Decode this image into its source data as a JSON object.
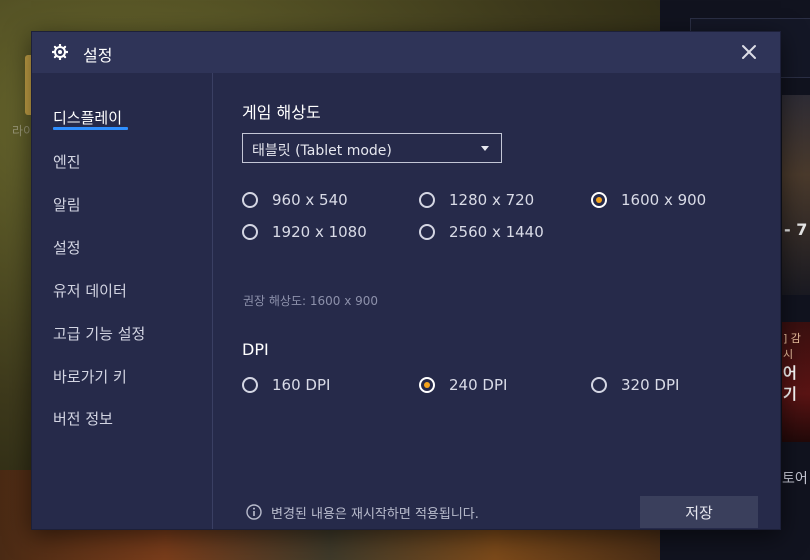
{
  "background": {
    "left_label": "라이",
    "right_card_text": "- 7",
    "right_card2_top": "] 감시",
    "right_card2_text": "어 기",
    "right_side_label": "토어"
  },
  "dialog": {
    "title": "설정",
    "icons": {
      "title": "gear-icon",
      "close": "close-icon",
      "info": "info-icon"
    },
    "colors": {
      "accent_underline": "#2f8fff",
      "radio_selected": "#f5a31b",
      "dialog_bg": "#262a4a",
      "titlebar_bg": "#2f3458"
    }
  },
  "sidebar": {
    "items": [
      {
        "label": "디스플레이",
        "active": true
      },
      {
        "label": "엔진",
        "active": false
      },
      {
        "label": "알림",
        "active": false
      },
      {
        "label": "설정",
        "active": false
      },
      {
        "label": "유저 데이터",
        "active": false
      },
      {
        "label": "고급 기능 설정",
        "active": false
      },
      {
        "label": "바로가기 키",
        "active": false
      },
      {
        "label": "버전 정보",
        "active": false
      }
    ]
  },
  "display": {
    "resolution_section_title": "게임 해상도",
    "mode_dropdown_value": "태블릿 (Tablet mode)",
    "resolutions": [
      {
        "label": "960 x 540",
        "selected": false
      },
      {
        "label": "1280 x 720",
        "selected": false
      },
      {
        "label": "1600 x 900",
        "selected": true
      },
      {
        "label": "1920 x 1080",
        "selected": false
      },
      {
        "label": "2560 x 1440",
        "selected": false
      }
    ],
    "recommended_hint": "권장 해상도: 1600 x 900",
    "dpi_section_title": "DPI",
    "dpi_options": [
      {
        "label": "160 DPI",
        "selected": false
      },
      {
        "label": "240 DPI",
        "selected": true
      },
      {
        "label": "320 DPI",
        "selected": false
      }
    ],
    "footer_note": "변경된 내용은 재시작하면 적용됩니다.",
    "save_label": "저장"
  }
}
